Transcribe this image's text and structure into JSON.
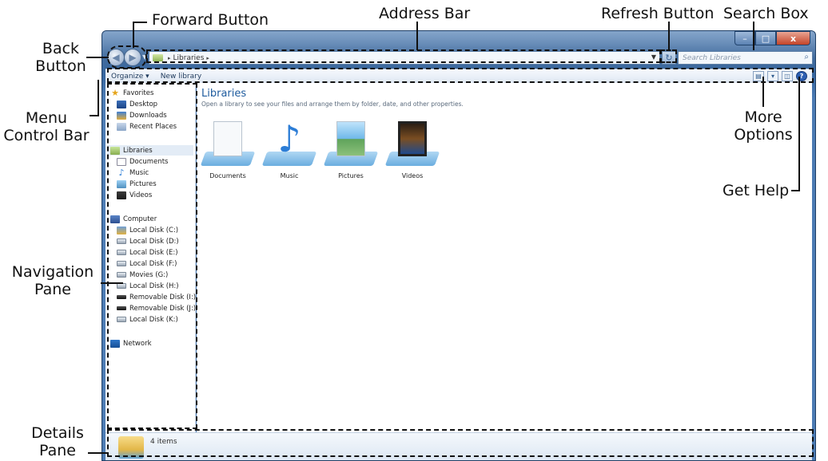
{
  "annotations": {
    "forward_button": "Forward Button",
    "address_bar": "Address Bar",
    "refresh_button": "Refresh Button",
    "search_box": "Search Box",
    "back_button_line1": "Back",
    "back_button_line2": "Button",
    "menu_control_bar_line1": "Menu",
    "menu_control_bar_line2": "Control Bar",
    "more_options_line1": "More",
    "more_options_line2": "Options",
    "get_help": "Get Help",
    "navigation_pane_line1": "Navigation",
    "navigation_pane_line2": "Pane",
    "details_pane_line1": "Details",
    "details_pane_line2": "Pane"
  },
  "window": {
    "buttons": {
      "minimize": "–",
      "maximize": "□",
      "close": "x"
    }
  },
  "address_bar": {
    "path": "Libraries",
    "separator": "▸"
  },
  "search": {
    "placeholder": "Search Libraries"
  },
  "toolbar": {
    "organize": "Organize ▾",
    "new_library": "New library"
  },
  "nav_pane": {
    "favorites": "Favorites",
    "desktop": "Desktop",
    "downloads": "Downloads",
    "recent_places": "Recent Places",
    "libraries": "Libraries",
    "documents": "Documents",
    "music": "Music",
    "pictures": "Pictures",
    "videos": "Videos",
    "computer": "Computer",
    "disk_c": "Local Disk (C:)",
    "disk_d": "Local Disk (D:)",
    "disk_e": "Local Disk (E:)",
    "disk_f": "Local Disk (F:)",
    "movies_g": "Movies (G:)",
    "disk_h": "Local Disk (H:)",
    "removable_i": "Removable Disk (I:)",
    "removable_j": "Removable Disk (J:)",
    "disk_k": "Local Disk (K:)",
    "network": "Network"
  },
  "content": {
    "title": "Libraries",
    "subtitle": "Open a library to see your files and arrange them by folder, date, and other properties.",
    "items": [
      "Documents",
      "Music",
      "Pictures",
      "Videos"
    ]
  },
  "details": {
    "count": "4 items"
  }
}
